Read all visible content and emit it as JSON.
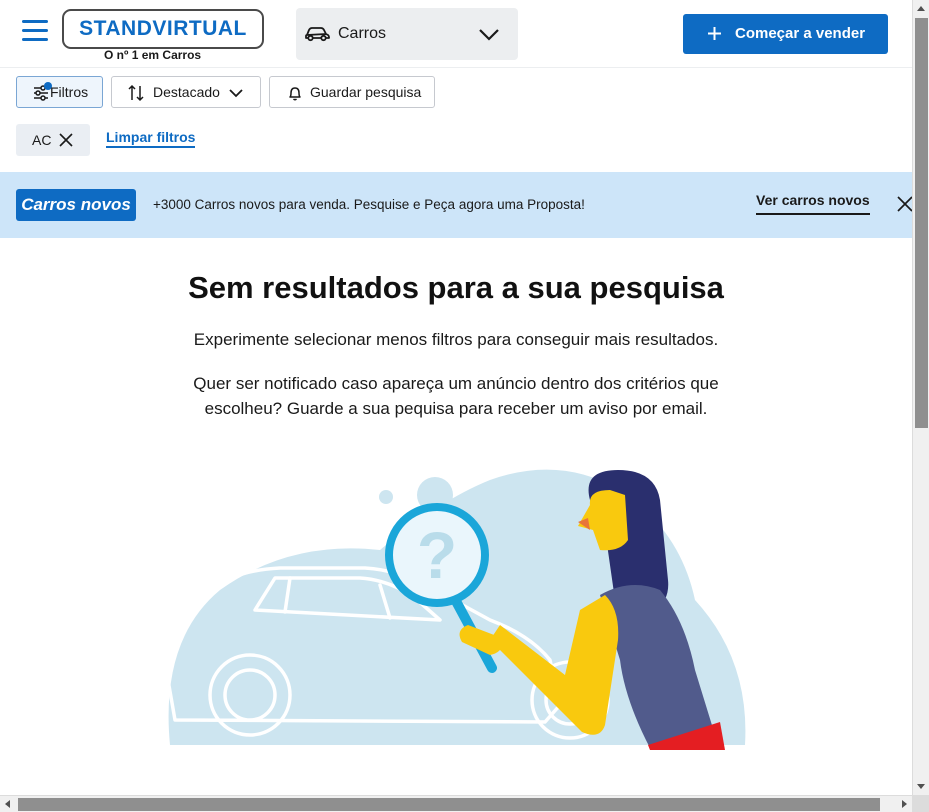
{
  "header": {
    "logo_text": "STANDVIRTUAL",
    "logo_tagline": "O nº 1 em Carros",
    "category": {
      "label": "Carros",
      "icon": "car-icon"
    },
    "sell_button": "Começar a vender",
    "brand_color": "#0e6bc3"
  },
  "toolbar": {
    "filters_label": "Filtros",
    "sort_label": "Destacado",
    "save_search_label": "Guardar pesquisa"
  },
  "active_filters": {
    "chips": [
      {
        "label": "AC"
      }
    ],
    "clear_label": "Limpar filtros"
  },
  "banner": {
    "badge": "Carros novos",
    "text": "+3000 Carros novos para venda. Pesquise e Peça agora uma Proposta!",
    "link": "Ver carros novos",
    "background": "#cde5f9"
  },
  "empty_state": {
    "title": "Sem resultados para a sua pesquisa",
    "line1": "Experimente selecionar menos filtros para conseguir mais resultados.",
    "line2": "Quer ser notificado caso apareça um anúncio dentro dos critérios que escolheu? Guarde a sua pequisa para receber um aviso por email.",
    "illustration": "woman-with-magnifying-glass-and-car"
  }
}
